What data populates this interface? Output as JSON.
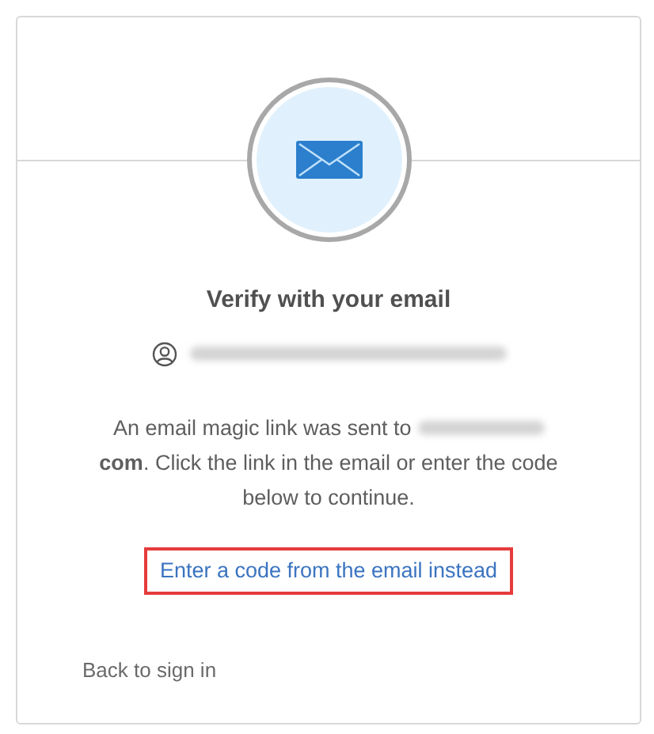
{
  "title": "Verify with your email",
  "message": {
    "before": "An email magic link was sent to",
    "after": "**com**. Click the link in the email or enter the code below to continue."
  },
  "code_link": {
    "label": "Enter a code from the email instead",
    "highlighted": true
  },
  "back_link": "Back to sign in"
}
